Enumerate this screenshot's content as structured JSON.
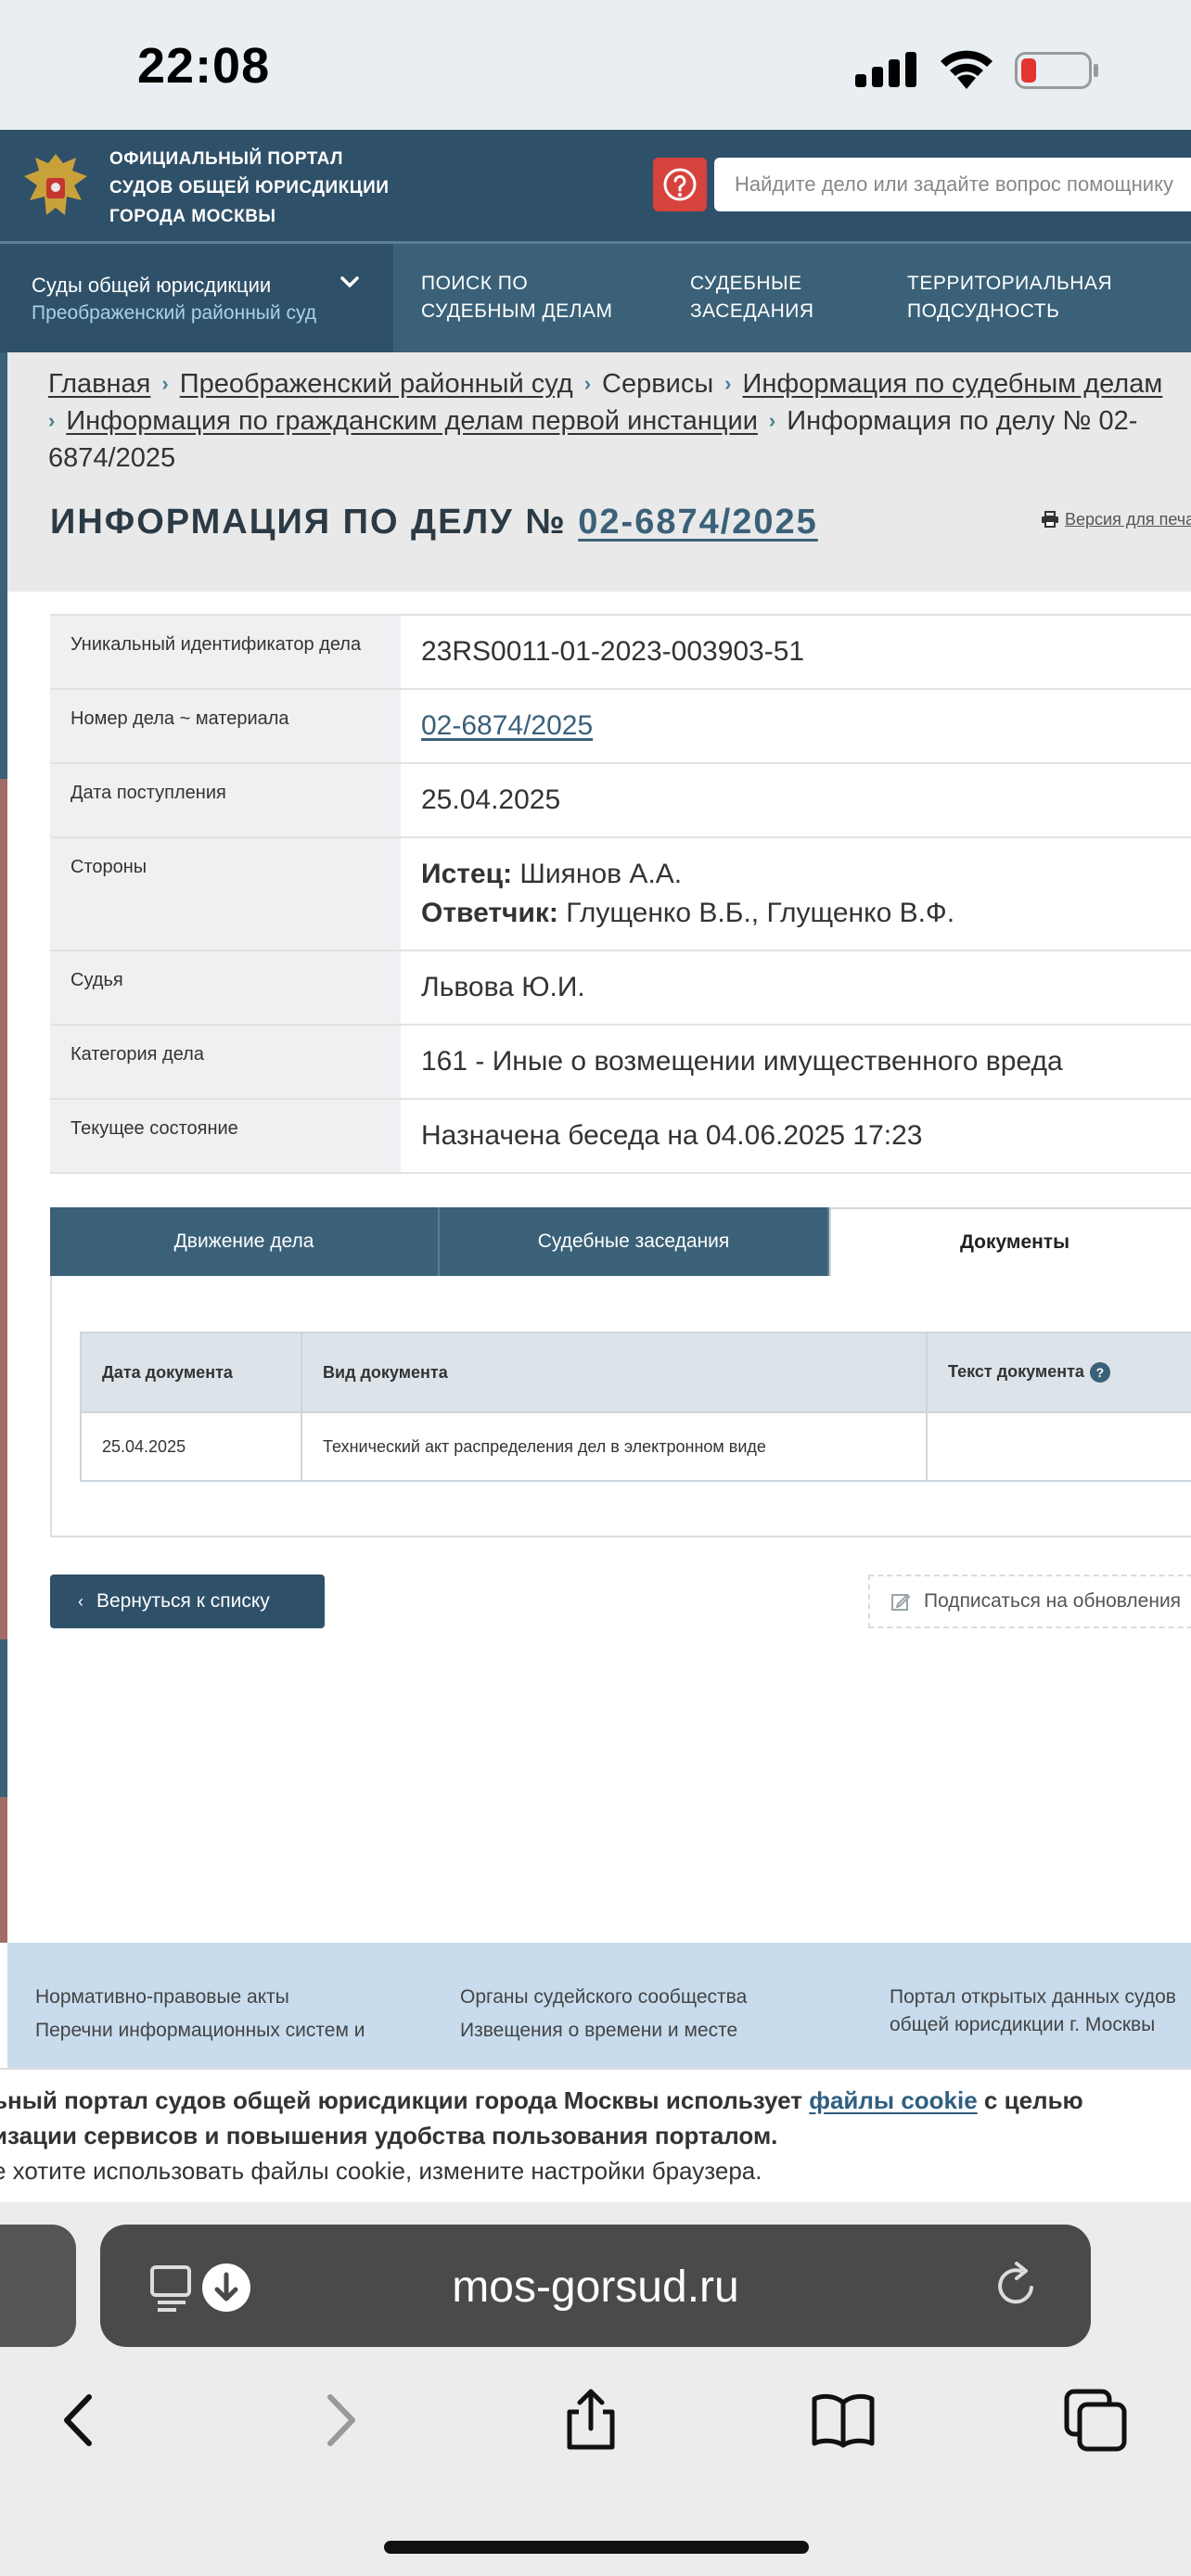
{
  "status_bar": {
    "time": "22:08"
  },
  "header": {
    "portal_name_lines": [
      "ОФИЦИАЛЬНЫЙ ПОРТАЛ",
      "СУДОВ ОБЩЕЙ ЮРИСДИКЦИИ",
      "ГОРОДА МОСКВЫ"
    ],
    "search_placeholder": "Найдите дело или задайте вопрос помощнику"
  },
  "nav": {
    "court_title": "Суды общей юрисдикции",
    "court_subtitle": "Преображенский районный суд",
    "links": [
      {
        "line1": "ПОИСК ПО",
        "line2": "СУДЕБНЫМ ДЕЛАМ"
      },
      {
        "line1": "СУДЕБНЫЕ",
        "line2": "ЗАСЕДАНИЯ"
      },
      {
        "line1": "ТЕРРИТОРИАЛЬНАЯ",
        "line2": "ПОДСУДНОСТЬ"
      }
    ]
  },
  "breadcrumb": {
    "home": "Главная",
    "court": "Преображенский районный суд",
    "services": "Сервисы",
    "cases_info": "Информация по судебным делам",
    "civil_cases": "Информация по гражданским делам первой инстанции",
    "current_a": "Информация по делу № 02-",
    "current_b": "6874/2025"
  },
  "page": {
    "title_prefix": "ИНФОРМАЦИЯ ПО ДЕЛУ №",
    "case_number": "02-6874/2025",
    "print_label": "Версия для печати"
  },
  "case_info": {
    "uid_label": "Уникальный идентификатор дела",
    "uid_value": "23RS0011-01-2023-003903-51",
    "number_label": "Номер дела ~ материала",
    "number_value": "02-6874/2025",
    "received_label": "Дата поступления",
    "received_value": "25.04.2025",
    "parties_label": "Стороны",
    "plaintiff_label": "Истец:",
    "plaintiff_value": "Шиянов А.А.",
    "defendant_label": "Ответчик:",
    "defendant_value": "Глущенко В.Б., Глущенко В.Ф.",
    "judge_label": "Судья",
    "judge_value": "Львова Ю.И.",
    "category_label": "Категория дела",
    "category_value": "161 - Иные о возмещении имущественного вреда",
    "status_label": "Текущее состояние",
    "status_value": "Назначена беседа на 04.06.2025 17:23"
  },
  "tabs": {
    "movement": "Движение дела",
    "hearings": "Судебные заседания",
    "documents": "Документы"
  },
  "documents": {
    "headers": [
      "Дата документа",
      "Вид документа",
      "Текст документа"
    ],
    "rows": [
      {
        "date": "25.04.2025",
        "type": "Технический акт распределения дел в электронном виде",
        "text": ""
      }
    ]
  },
  "actions": {
    "back": "Вернуться к списку",
    "subscribe": "Подписаться на обновления"
  },
  "footer": {
    "col1": [
      "Нормативно-правовые акты",
      "Перечни информационных систем и"
    ],
    "col2": [
      "Органы судейского сообщества",
      "Извещения о времени и месте"
    ],
    "col3": [
      "Портал открытых данных судов",
      "общей юрисдикции г. Москвы"
    ]
  },
  "cookie": {
    "l1_a": "ьный портал судов общей юрисдикции города Москвы использует ",
    "l1_link": "файлы cookie",
    "l1_b": " с целью",
    "l2": "изации сервисов и повышения удобства пользования порталом.",
    "l3": "е хотите использовать файлы cookie, измените настройки браузера."
  },
  "browser": {
    "url": "mos-gorsud.ru"
  },
  "colors": {
    "header": "#2f5069",
    "nav": "#3a6178",
    "accent_red": "#d8423d",
    "footer": "#c8dcee"
  }
}
